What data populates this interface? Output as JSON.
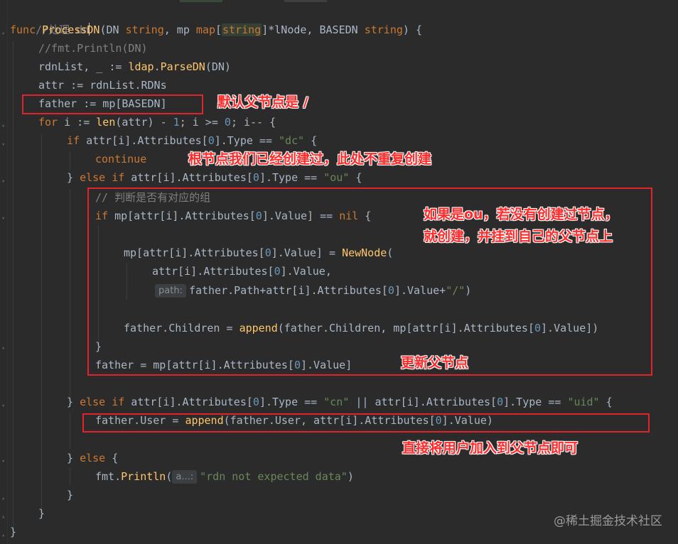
{
  "code": {
    "l1_comment": "//处理 dn",
    "l2": {
      "func": "func",
      "name": "ProcessDN",
      "p1": "(DN",
      "t1": "string",
      "p2": ", mp",
      "map": "map",
      "t2": "string",
      "p3": "]*lNode, BASEDN",
      "t3": "string",
      "p4": ") {"
    },
    "l3_comment": "//fmt.Println(DN)",
    "l4": {
      "a": "rdnList, _ := ",
      "pkg": "ldap",
      "b": ".",
      "fn": "ParseDN",
      "c": "(DN)"
    },
    "l5": "attr := rdnList.RDNs",
    "l6": "father := mp[BASEDN]",
    "l7": {
      "kw": "for",
      "a": " i := ",
      "fn": "len",
      "b": "(attr) - ",
      "n1": "1",
      "c": "; i >= ",
      "n2": "0",
      "d": "; i-- {"
    },
    "l8": {
      "kw": "if",
      "a": " attr[i].Attributes[",
      "n": "0",
      "b": "].Type == ",
      "s": "\"dc\"",
      "c": " {"
    },
    "l9": "continue",
    "l10": {
      "a": "} ",
      "kw1": "else",
      "sp": " ",
      "kw2": "if",
      "b": " attr[i].Attributes[",
      "n": "0",
      "c": "].Type == ",
      "s": "\"ou\"",
      "d": " {"
    },
    "l11_comment": "// 判断是否有对应的组",
    "l12": {
      "kw": "if",
      "a": " mp[attr[i].Attributes[",
      "n": "0",
      "b": "].Value] == ",
      "nil": "nil",
      "c": " {"
    },
    "l14": {
      "a": "mp[attr[i].Attributes[",
      "n": "0",
      "b": "].Value] = ",
      "fn": "NewNode",
      "c": "("
    },
    "l15": {
      "a": "attr[i].Attributes[",
      "n": "0",
      "b": "].Value,"
    },
    "l16": {
      "hint": "path:",
      "a": "father.Path+attr[i].Attributes[",
      "n": "0",
      "b": "].Value+",
      "s": "\"/\"",
      "c": ")"
    },
    "l18": {
      "a": "father.Children = ",
      "fn": "append",
      "b": "(father.Children, mp[attr[i].Attributes[",
      "n": "0",
      "c": "].Value])"
    },
    "l19": "}",
    "l20": {
      "a": "father = mp[attr[i].Attributes[",
      "n": "0",
      "b": "].Value]"
    },
    "l22": {
      "a": "} ",
      "kw1": "else",
      "sp": " ",
      "kw2": "if",
      "b": " attr[i].Attributes[",
      "n1": "0",
      "c": "].Type == ",
      "s1": "\"cn\"",
      "d": " || attr[i].Attributes[",
      "n2": "0",
      "e": "].Type == ",
      "s2": "\"uid\"",
      "f": " {"
    },
    "l23": {
      "a": "father.User = ",
      "fn": "append",
      "b": "(father.User, attr[i].Attributes[",
      "n": "0",
      "c": "].Value)"
    },
    "l25": {
      "a": "} ",
      "kw": "else",
      "b": " {"
    },
    "l26": {
      "a": "fmt.",
      "fn": "Println",
      "b": "(",
      "hint": "a...:",
      "s": "\"rdn not expected data\"",
      "c": ")"
    },
    "l27": "}",
    "l28": "}",
    "l29": "}"
  },
  "annotations": {
    "father_default": "默认父节点是 /",
    "root_created": "根节点我们已经创建过，此处不重复创建",
    "ou_line1": "如果是ou，若没有创建过节点，",
    "ou_line2": "就创建，并挂到自己的父节点上",
    "update_father": "更新父节点",
    "add_user": "直接将用户加入到父节点即可"
  },
  "watermark": "@稀土掘金技术社区",
  "colors": {
    "annotation": "#e3232b",
    "background": "#2b2b2b"
  }
}
